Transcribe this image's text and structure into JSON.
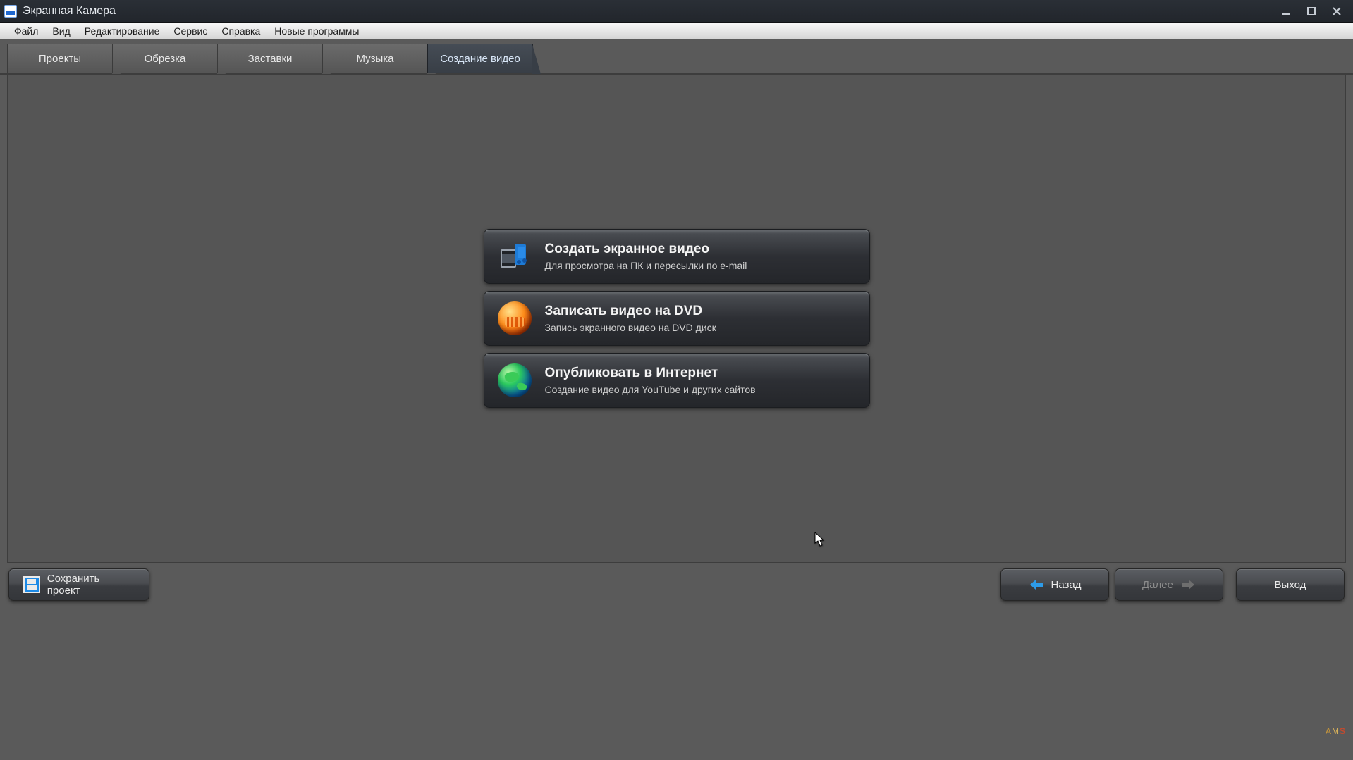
{
  "window": {
    "title": "Экранная Камера"
  },
  "menu": {
    "items": [
      "Файл",
      "Вид",
      "Редактирование",
      "Сервис",
      "Справка",
      "Новые программы"
    ]
  },
  "tabs": {
    "items": [
      {
        "label": "Проекты"
      },
      {
        "label": "Обрезка"
      },
      {
        "label": "Заставки"
      },
      {
        "label": "Музыка"
      },
      {
        "label": "Создание видео"
      }
    ],
    "activeIndex": 4
  },
  "options": [
    {
      "icon": "film-music-icon",
      "title": "Создать экранное видео",
      "subtitle": "Для просмотра на ПК и пересылки по e-mail"
    },
    {
      "icon": "dvd-disc-icon",
      "title": "Записать видео на DVD",
      "subtitle": "Запись экранного видео на DVD диск"
    },
    {
      "icon": "globe-icon",
      "title": "Опубликовать в Интернет",
      "subtitle": "Создание видео для YouTube и других сайтов"
    }
  ],
  "footer": {
    "save_label": "Сохранить проект",
    "back_label": "Назад",
    "next_label": "Далее",
    "exit_label": "Выход"
  },
  "brand": {
    "text": "AMS"
  }
}
